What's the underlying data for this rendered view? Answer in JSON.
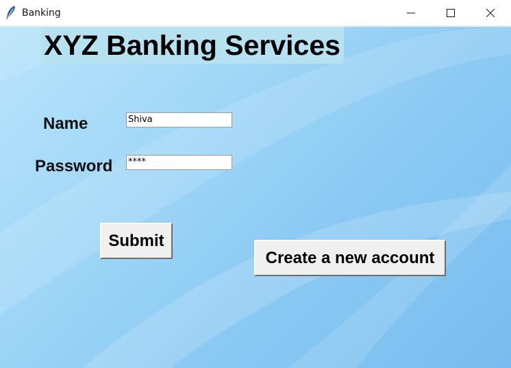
{
  "window": {
    "title": "Banking",
    "controls": {
      "minimize_icon": "minimize-icon",
      "maximize_icon": "maximize-icon",
      "close_icon": "close-icon"
    }
  },
  "form": {
    "heading": "XYZ Banking Services",
    "name_label": "Name",
    "name_value": "Shiva",
    "password_label": "Password",
    "password_value": "****",
    "submit_label": "Submit",
    "create_account_label": "Create a new account"
  },
  "colors": {
    "background_light": "#b9e4fb",
    "background_dark": "#78bcef",
    "heading_bg": "#b6e1f1",
    "button_bg": "#f0f0f0"
  }
}
